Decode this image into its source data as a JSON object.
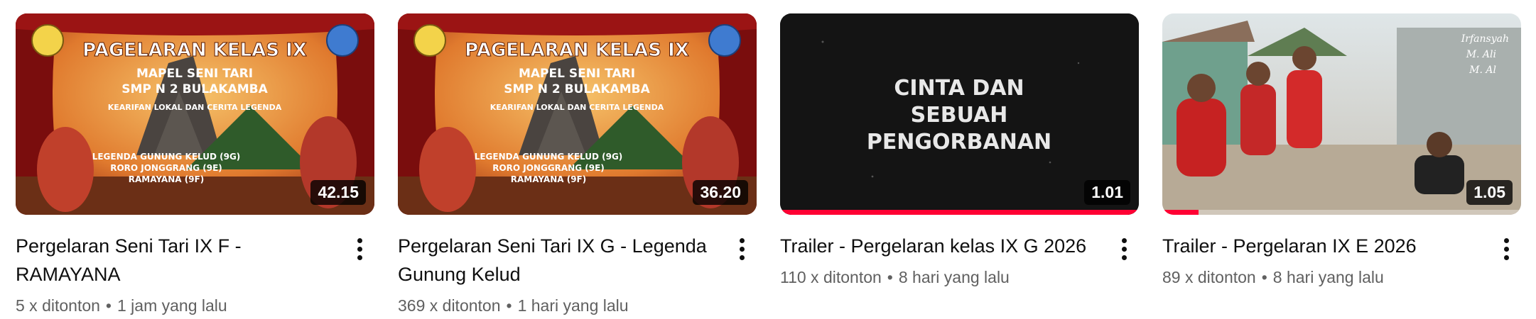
{
  "videos": [
    {
      "title": "Pergelaran Seni Tari IX F - RAMAYANA",
      "views": "5 x ditonton",
      "time": "1 jam yang lalu",
      "duration": "42.15",
      "progress": 0,
      "thumb": {
        "line1": "PAGELARAN KELAS IX",
        "line2": "MAPEL SENI TARI",
        "line3": "SMP N 2 BULAKAMBA",
        "line4": "KEARIFAN LOKAL DAN CERITA LEGENDA",
        "list1": "LEGENDA GUNUNG KELUD (9G)",
        "list2": "RORO JONGGRANG (9E)",
        "list3": "RAMAYANA (9F)"
      }
    },
    {
      "title": "Pergelaran Seni Tari IX G - Legenda Gunung Kelud",
      "views": "369 x ditonton",
      "time": "1 hari yang lalu",
      "duration": "36.20",
      "progress": 0,
      "thumb": {
        "line1": "PAGELARAN KELAS IX",
        "line2": "MAPEL SENI TARI",
        "line3": "SMP N 2 BULAKAMBA",
        "line4": "KEARIFAN LOKAL DAN CERITA LEGENDA",
        "list1": "LEGENDA GUNUNG KELUD (9G)",
        "list2": "RORO JONGGRANG (9E)",
        "list3": "RAMAYANA (9F)"
      }
    },
    {
      "title": "Trailer - Pergelaran kelas IX G 2026",
      "views": "110 x ditonton",
      "time": "8 hari yang lalu",
      "duration": "1.01",
      "progress": 1.0,
      "thumb": {
        "line1": "CINTA DAN",
        "line2": "SEBUAH",
        "line3": "PENGORBANAN"
      }
    },
    {
      "title": "Trailer - Pergelaran IX E 2026",
      "views": "89 x ditonton",
      "time": "8 hari yang lalu",
      "duration": "1.05",
      "progress": 0.1,
      "thumb": {
        "credit1": "Irfansyah",
        "credit2": "M. Ali",
        "credit3": "M. Al"
      }
    }
  ],
  "separator": "•",
  "colors": {
    "progress": "#ff0033",
    "title": "#0f0f0f",
    "meta": "#606060"
  }
}
